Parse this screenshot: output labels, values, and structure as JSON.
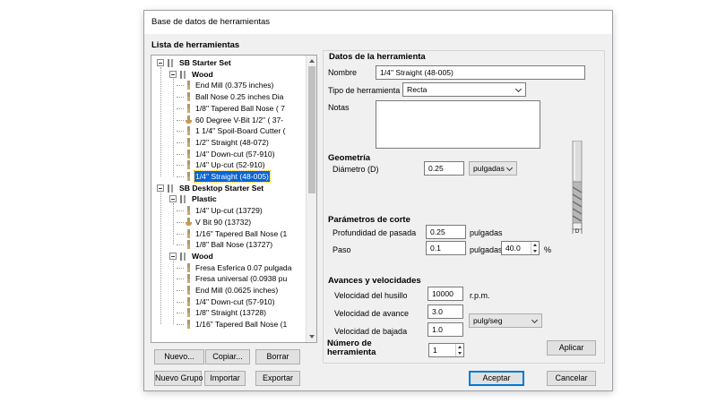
{
  "window": {
    "title": "Base de datos de herramientas"
  },
  "tool_list": {
    "label": "Lista de herramientas",
    "rows": [
      {
        "label": "SB Starter Set",
        "kind": "folder",
        "level": 0,
        "bold": true
      },
      {
        "label": "Wood",
        "kind": "folder",
        "level": 1,
        "bold": true
      },
      {
        "label": "End Mill (0.375 inches)",
        "kind": "tool",
        "level": 2
      },
      {
        "label": "Ball Nose 0.25 inches Dia",
        "kind": "tool",
        "level": 2
      },
      {
        "label": "1/8\" Tapered Ball Nose ( 7",
        "kind": "tool",
        "level": 2
      },
      {
        "label": "60 Degree V-Bit 1/2\" ( 37-",
        "kind": "tool-vbit",
        "level": 2
      },
      {
        "label": "1 1/4\" Spoil-Board Cutter (",
        "kind": "tool",
        "level": 2
      },
      {
        "label": "1/2\" Straight  (48-072)",
        "kind": "tool",
        "level": 2
      },
      {
        "label": "1/4\"  Down-cut (57-910)",
        "kind": "tool",
        "level": 2
      },
      {
        "label": "1/4\" Up-cut (52-910)",
        "kind": "tool",
        "level": 2
      },
      {
        "label": "1/4\" Straight  (48-005)",
        "kind": "tool",
        "level": 2,
        "selected": true
      },
      {
        "label": "SB Desktop Starter Set",
        "kind": "folder",
        "level": 0,
        "bold": true
      },
      {
        "label": "Plastic",
        "kind": "folder",
        "level": 1,
        "bold": true
      },
      {
        "label": "1/4\" Up-cut (13729)",
        "kind": "tool",
        "level": 2
      },
      {
        "label": "V Bit 90 (13732)",
        "kind": "tool-vbit",
        "level": 2
      },
      {
        "label": "1/16\" Tapered Ball Nose (1",
        "kind": "tool",
        "level": 2
      },
      {
        "label": "1/8\" Ball Nose (13727)",
        "kind": "tool",
        "level": 2
      },
      {
        "label": "Wood",
        "kind": "folder",
        "level": 1,
        "bold": true
      },
      {
        "label": "Fresa Esferica 0.07 pulgada",
        "kind": "tool",
        "level": 2
      },
      {
        "label": "Fresa universal (0.0938 pu",
        "kind": "tool",
        "level": 2
      },
      {
        "label": "End Mill (0.0625 inches)",
        "kind": "tool",
        "level": 2
      },
      {
        "label": "1/4\"  Down-cut (57-910)",
        "kind": "tool",
        "level": 2
      },
      {
        "label": "1/8\" Straight (13728)",
        "kind": "tool",
        "level": 2
      },
      {
        "label": "1/16\" Tapered Ball Nose (1",
        "kind": "tool",
        "level": 2
      }
    ]
  },
  "buttons": {
    "new": "Nuevo...",
    "copy": "Copiar...",
    "delete": "Borrar",
    "new_group": "Nuevo Grupo",
    "import": "Importar",
    "export": "Exportar",
    "apply": "Aplicar",
    "accept": "Aceptar",
    "cancel": "Cancelar"
  },
  "tool_data": {
    "section_title": "Datos de la herramienta",
    "name_label": "Nombre",
    "name_value": "1/4\" Straight  (48-005)",
    "type_label": "Tipo de herramienta",
    "type_value": "Recta",
    "notes_label": "Notas",
    "notes_value": ""
  },
  "geometry": {
    "title": "Geometría",
    "diameter_label": "Diámetro (D)",
    "diameter_value": "0.25",
    "units_value": "pulgadas"
  },
  "cutting": {
    "title": "Parámetros de corte",
    "pass_depth_label": "Profundidad de pasada",
    "pass_depth_value": "0.25",
    "pass_depth_unit": "pulgadas",
    "stepover_label": "Paso",
    "stepover_value": "0.1",
    "stepover_unit": "pulgadas",
    "stepover_percent": "40.0",
    "percent_sign": "%"
  },
  "feeds": {
    "title": "Avances y velocidades",
    "spindle_label": "Velocidad del husillo",
    "spindle_value": "10000",
    "spindle_unit": "r.p.m.",
    "feed_label": "Velocidad de avance",
    "feed_value": "3.0",
    "plunge_label": "Velocidad de bajada",
    "plunge_value": "1.0",
    "rate_units_value": "pulg/seg"
  },
  "tool_number": {
    "label": "Número de herramienta",
    "value": "1"
  },
  "diagram": {
    "dimension_label": "D"
  },
  "colors": {
    "selection": "#0a64d4",
    "accent": "#0078d7",
    "bit_gold": "#c8a96a"
  }
}
